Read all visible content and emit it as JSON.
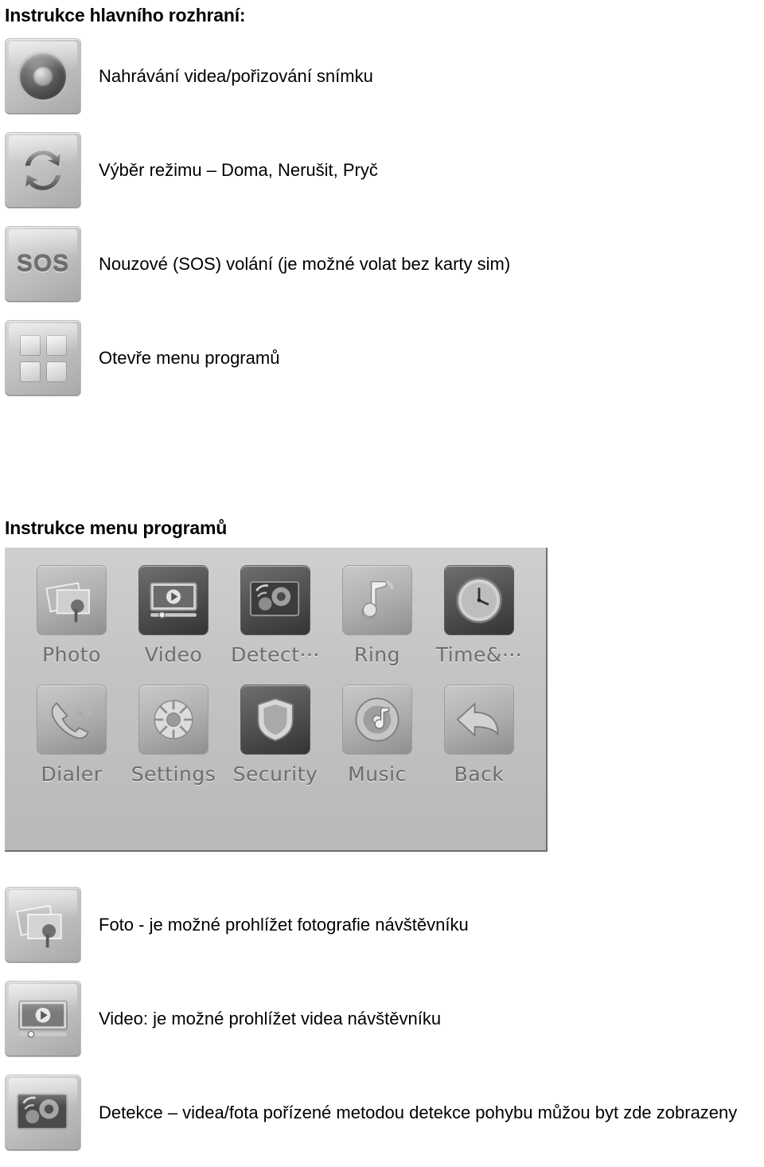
{
  "document": {
    "headings": {
      "main_interface": "Instrukce hlavního rozhraní:",
      "program_menu": "Instrukce menu programů"
    },
    "main_interface_rows": [
      {
        "icon": "camera-record-icon",
        "label": "Nahrávání videa/pořizování snímku"
      },
      {
        "icon": "mode-switch-icon",
        "label": "Výběr režimu – Doma, Nerušit, Pryč"
      },
      {
        "icon": "sos-icon",
        "label": "Nouzové (SOS) volání (je možné volat bez karty sim)"
      },
      {
        "icon": "app-grid-icon",
        "label": "Otevře menu programů"
      }
    ],
    "device_screen": {
      "apps": [
        {
          "name": "photo-app",
          "label": "Photo"
        },
        {
          "name": "video-app",
          "label": "Video"
        },
        {
          "name": "detect-app",
          "label": "Detect···"
        },
        {
          "name": "ring-app",
          "label": "Ring"
        },
        {
          "name": "time-app",
          "label": "Time&···"
        },
        {
          "name": "dialer-app",
          "label": "Dialer"
        },
        {
          "name": "settings-app",
          "label": "Settings"
        },
        {
          "name": "security-app",
          "label": "Security"
        },
        {
          "name": "music-app",
          "label": "Music"
        },
        {
          "name": "back-app",
          "label": "Back"
        }
      ]
    },
    "description_rows": [
      {
        "icon": "photo-icon",
        "label": "Foto - je možné prohlížet fotografie návštěvníku"
      },
      {
        "icon": "video-icon",
        "label": "Video: je možné prohlížet videa návštěvníku"
      },
      {
        "icon": "detect-icon",
        "label": "Detekce – videa/fota pořízené metodou detekce pohybu můžou byt zde zobrazeny"
      }
    ],
    "colors": {
      "text": "#000000",
      "screen_label": "#6d6d6d",
      "bezel_light": "#d9d9d9",
      "bezel_dark": "#a8a8a8"
    }
  }
}
